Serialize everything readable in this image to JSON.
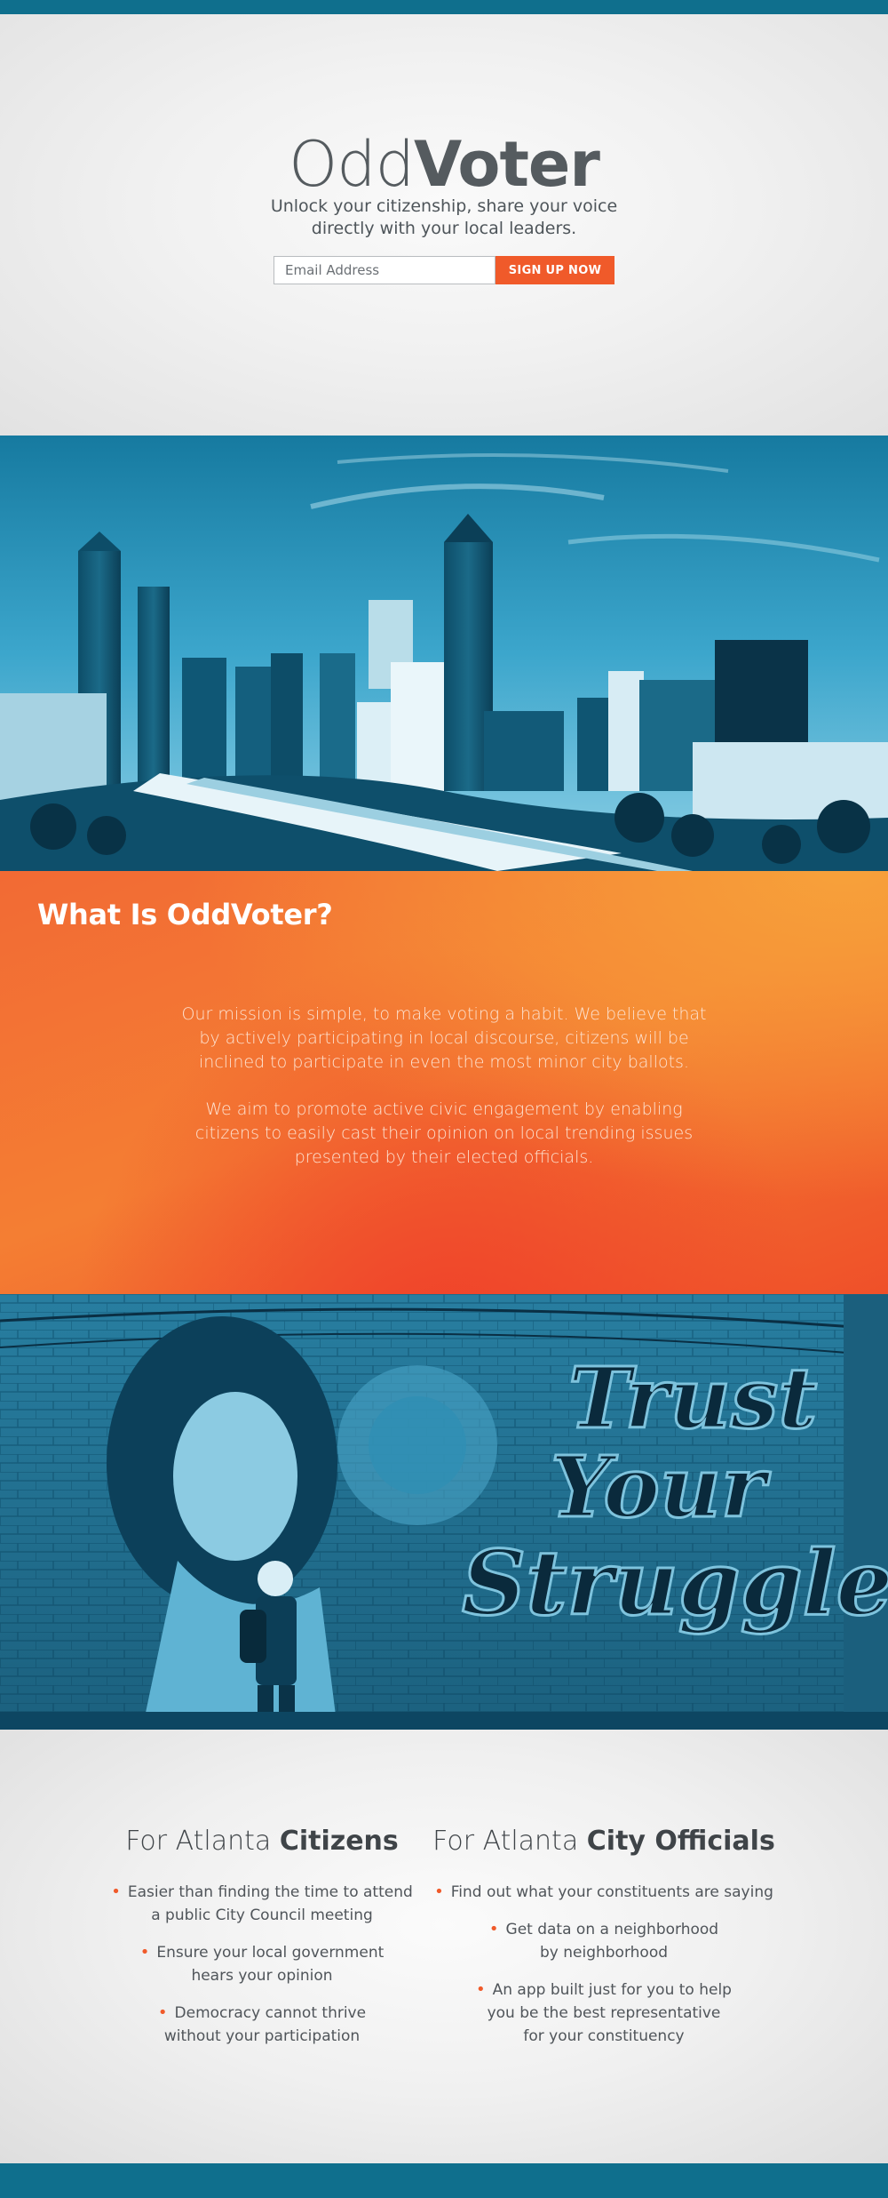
{
  "brand": {
    "name_light": "Odd",
    "name_bold": "Voter"
  },
  "hero": {
    "tagline_line1": "Unlock your citizenship, share your voice",
    "tagline_line2": "directly with your local leaders.",
    "email_placeholder": "Email Address",
    "signup_label": "SIGN UP NOW"
  },
  "mission": {
    "title": "What Is OddVoter?",
    "p1": "Our mission is simple, to make voting a habit. We believe that by actively participating in local discourse, citizens will be inclined to participate in even the most minor city ballots.",
    "p2": "We aim to promote active civic engagement by enabling citizens to easily cast their opinion on local trending issues presented by their elected officials."
  },
  "mural": {
    "text_lines": [
      "Trust",
      "Your",
      "Struggle"
    ]
  },
  "features": {
    "citizens": {
      "title_light": "For Atlanta",
      "title_bold": "Citizens",
      "items": [
        "Easier than finding the time to attend\na public City Council meeting",
        "Ensure your local government\nhears your opinion",
        "Democracy cannot thrive\nwithout your participation"
      ]
    },
    "officials": {
      "title_light": "For Atlanta",
      "title_bold": "City Officials",
      "items": [
        "Find out what your constituents are saying",
        "Get data on a neighborhood\nby neighborhood",
        "An app built just for you to help\nyou be the best representative\nfor your constituency"
      ]
    }
  },
  "colors": {
    "accent": "#f05a2a",
    "brand_blue": "#0f6f8d",
    "text_dark": "#555b5f"
  }
}
